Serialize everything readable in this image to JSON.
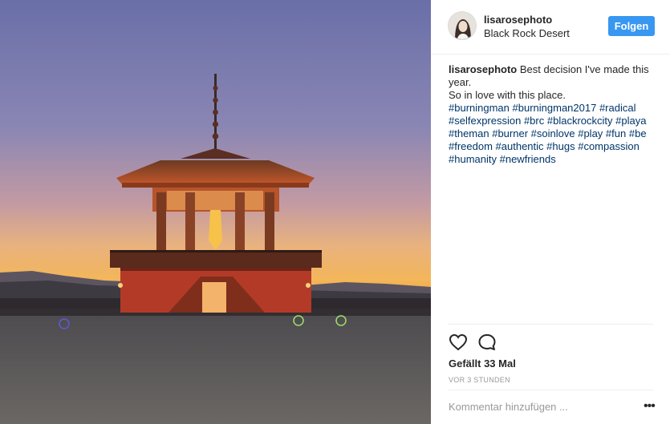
{
  "post": {
    "image_alt": "Pagoda structure at sunset in the desert",
    "author": {
      "username": "lisarosephoto",
      "location": "Black Rock Desert"
    },
    "follow_label": "Folgen",
    "caption": {
      "username": "lisarosephoto",
      "line1": "Best decision I've made this",
      "line2": "year.",
      "line3": "So in love with this place.",
      "hashtags_row1": [
        "#burningman",
        "#burningman2017",
        "#radical"
      ],
      "hashtags_row2": [
        "#selfexpression",
        "#brc",
        "#blackrockcity",
        "#playa"
      ],
      "hashtags_row3": [
        "#theman",
        "#burner",
        "#soinlove",
        "#play",
        "#fun",
        "#be"
      ],
      "hashtags_row4": [
        "#freedom",
        "#authentic",
        "#hugs",
        "#compassion"
      ],
      "hashtags_row5": [
        "#humanity",
        "#newfriends"
      ]
    },
    "icons": {
      "like": "heart-icon",
      "comment": "comment-icon",
      "more": "more-options-icon"
    },
    "likes": "Gefällt 33 Mal",
    "timestamp": "VOR 3 STUNDEN",
    "comment_placeholder": "Kommentar hinzufügen ...",
    "more_label": "•••"
  }
}
